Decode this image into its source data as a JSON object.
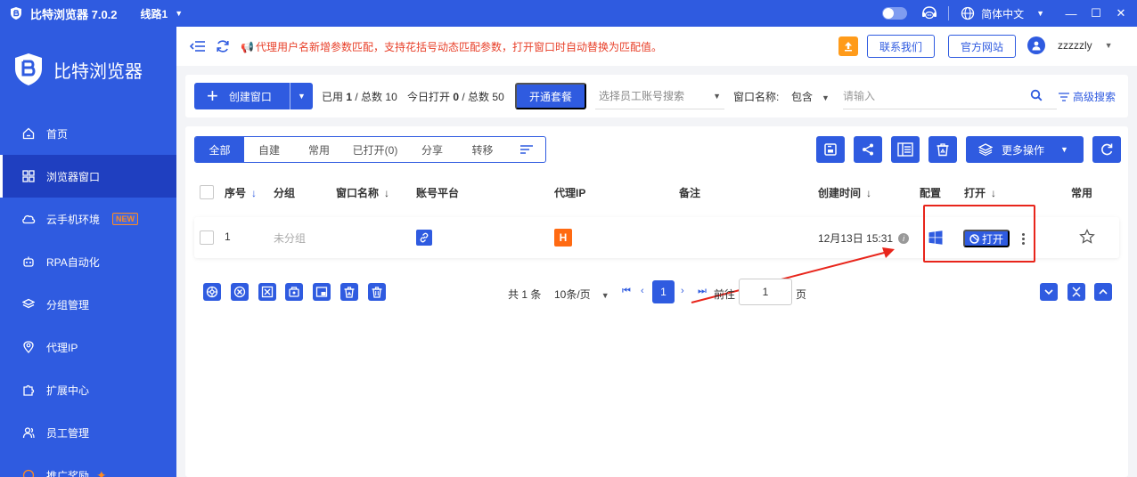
{
  "titlebar": {
    "app_name": "比特浏览器 7.0.2",
    "line": "线路1",
    "language": "简体中文",
    "minimize": "—",
    "maximize": "☐",
    "close": "✕"
  },
  "sidebar": {
    "brand": "比特浏览器",
    "items": [
      {
        "label": "首页",
        "icon": "home-icon"
      },
      {
        "label": "浏览器窗口",
        "icon": "grid-icon",
        "active": true
      },
      {
        "label": "云手机环境",
        "icon": "cloud-icon",
        "badge": "NEW"
      },
      {
        "label": "RPA自动化",
        "icon": "robot-icon"
      },
      {
        "label": "分组管理",
        "icon": "layers-icon"
      },
      {
        "label": "代理IP",
        "icon": "location-icon"
      },
      {
        "label": "扩展中心",
        "icon": "puzzle-icon"
      },
      {
        "label": "员工管理",
        "icon": "users-icon"
      },
      {
        "label": "推广奖励",
        "icon": "gift-icon"
      }
    ]
  },
  "notice": {
    "text": "代理用户名新增参数匹配，支持花括号动态匹配参数，打开窗口时自动替换为匹配值。",
    "contact_btn": "联系我们",
    "website_btn": "官方网站",
    "username": "zzzzzly"
  },
  "search": {
    "create_btn": "创建窗口",
    "used_label": "已用",
    "used_value": "1",
    "total_label": "/ 总数",
    "total_value": "10",
    "today_label": "今日打开",
    "today_value": "0",
    "today_total_label": "/ 总数",
    "today_total_value": "50",
    "plan_btn": "开通套餐",
    "staff_placeholder": "选择员工账号搜索",
    "window_name_label": "窗口名称:",
    "match_mode": "包含",
    "name_placeholder": "请输入",
    "advanced": "高级搜索"
  },
  "tabs": [
    {
      "label": "全部",
      "active": true
    },
    {
      "label": "自建"
    },
    {
      "label": "常用"
    },
    {
      "label": "已打开(0)"
    },
    {
      "label": "分享"
    },
    {
      "label": "转移"
    }
  ],
  "more_actions": "更多操作",
  "table": {
    "columns": {
      "seq": "序号",
      "group": "分组",
      "window_name": "窗口名称",
      "platform": "账号平台",
      "proxy": "代理IP",
      "remark": "备注",
      "created": "创建时间",
      "config": "配置",
      "open": "打开",
      "favorite": "常用"
    },
    "rows": [
      {
        "seq": "1",
        "group": "未分组",
        "window_name": "",
        "proxy_badge": "H",
        "remark": "",
        "created": "12月13日 15:31",
        "open_btn": "打开"
      }
    ]
  },
  "pager": {
    "total": "共 1 条",
    "page_size": "10条/页",
    "current": "1",
    "goto_label": "前往",
    "goto_value": "1",
    "page_suffix": "页"
  },
  "colors": {
    "brand": "#2f5be0",
    "warning": "#e8402a",
    "accent": "#ff9b1a",
    "highlight": "#e8251b"
  }
}
